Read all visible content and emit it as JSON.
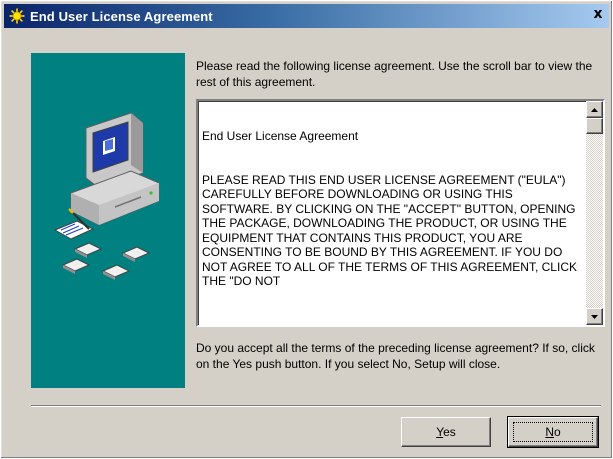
{
  "window": {
    "title": "End User License Agreement",
    "title_icon": "setup-sun-icon",
    "close_glyph": "x"
  },
  "intro": {
    "text": "Please read the following license agreement.  Use the scroll bar to view the rest of this agreement."
  },
  "license": {
    "heading": "End User License Agreement",
    "body": "PLEASE READ THIS END USER LICENSE AGREEMENT (\"EULA\") CAREFULLY BEFORE DOWNLOADING OR USING THIS SOFTWARE.  BY CLICKING ON THE \"ACCEPT\" BUTTON, OPENING THE PACKAGE, DOWNLOADING THE PRODUCT, OR USING THE EQUIPMENT THAT CONTAINS THIS PRODUCT, YOU ARE CONSENTING TO BE BOUND BY THIS AGREEMENT.  IF YOU DO NOT AGREE TO ALL OF THE TERMS OF THIS AGREEMENT, CLICK THE \"DO NOT",
    "scroll_position": 0.0
  },
  "question": {
    "text": "Do you accept all the terms of the preceding license agreement?  If so, click on the Yes push button.  If you select No, Setup will close."
  },
  "buttons": {
    "yes": {
      "mnemonic": "Y",
      "rest": "es"
    },
    "no": {
      "mnemonic": "N",
      "rest": "o"
    }
  },
  "colors": {
    "titlebar_start": "#0a246a",
    "titlebar_end": "#a6caf0",
    "side_panel": "#008080",
    "dialog_face": "#d4d0c8"
  },
  "icons": [
    "setup-sun-icon",
    "computer-icon",
    "document-icon",
    "floppy-disk-icon",
    "close-icon",
    "scroll-up-arrow-icon",
    "scroll-down-arrow-icon"
  ]
}
